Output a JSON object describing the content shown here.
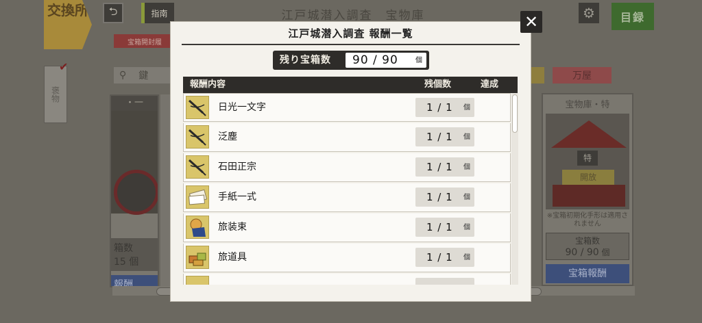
{
  "background": {
    "exchange_label": "交換所",
    "hint_label": "指南",
    "title": "江戸城潜入調査　宝物庫",
    "catalog_label": "目録",
    "red_tag": "宝箱開封履",
    "side_tab": "褒物",
    "key_label": "鍵",
    "shop_label": "万屋",
    "left_card": {
      "header": "・一",
      "count_label": "箱数",
      "count_value": "15",
      "count_unit": "個",
      "button": "報酬"
    },
    "right_card": {
      "header": "宝物庫・特",
      "special": "特",
      "open": "開放",
      "note": "※宝箱初期化手形は適用されません",
      "count_label": "宝箱数",
      "count_value": "90 / 90",
      "count_unit": "個",
      "button": "宝箱報酬"
    }
  },
  "modal": {
    "title": "江戸城潜入調査 報酬一覧",
    "counter_label": "残り宝箱数",
    "counter_value": "90 / 90",
    "counter_unit": "個",
    "columns": {
      "content": "報酬内容",
      "remaining": "残個数",
      "achieved": "達成"
    },
    "rows": [
      {
        "name": "日光一文字",
        "count": "1 / 1",
        "unit": "個",
        "icon": "sword-icon"
      },
      {
        "name": "泛塵",
        "count": "1 / 1",
        "unit": "個",
        "icon": "sword-icon"
      },
      {
        "name": "石田正宗",
        "count": "1 / 1",
        "unit": "個",
        "icon": "sword-icon"
      },
      {
        "name": "手紙一式",
        "count": "1 / 1",
        "unit": "個",
        "icon": "letter-icon"
      },
      {
        "name": "旅装束",
        "count": "1 / 1",
        "unit": "個",
        "icon": "outfit-icon"
      },
      {
        "name": "旅道具",
        "count": "1 / 1",
        "unit": "個",
        "icon": "tools-icon"
      },
      {
        "name": "",
        "count": "",
        "unit": "",
        "icon": "item-icon"
      }
    ],
    "close_label": "✕"
  }
}
